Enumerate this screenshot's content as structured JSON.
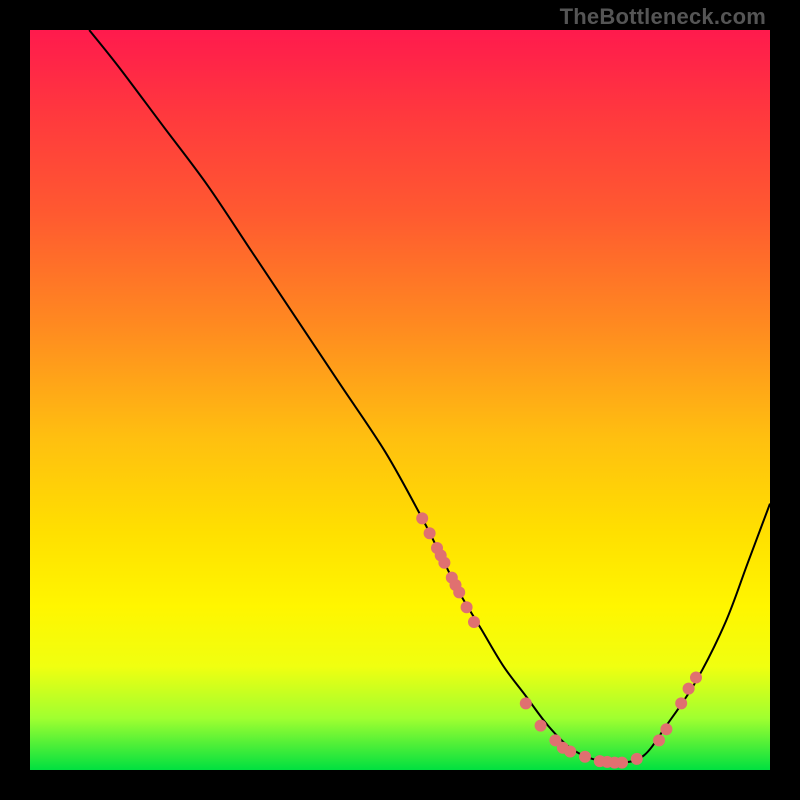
{
  "watermark": "TheBottleneck.com",
  "colors": {
    "dot": "#e07070",
    "curve": "#000000",
    "background_frame": "#000000"
  },
  "chart_data": {
    "type": "line",
    "title": "",
    "xlabel": "",
    "ylabel": "",
    "xlim": [
      0,
      100
    ],
    "ylim": [
      0,
      100
    ],
    "note": "Axes are unlabeled; values are estimated from pixel positions on a 0–100 normalized canvas, y measured from bottom (so 100 = top, 0 = bottom).",
    "series": [
      {
        "name": "curve",
        "x": [
          8,
          12,
          18,
          24,
          30,
          36,
          42,
          48,
          53,
          56,
          58,
          61,
          64,
          67,
          70,
          73,
          76,
          80,
          83,
          86,
          90,
          94,
          97,
          100
        ],
        "y": [
          100,
          95,
          87,
          79,
          70,
          61,
          52,
          43,
          34,
          28,
          24,
          19,
          14,
          10,
          6,
          3,
          1.5,
          1,
          2,
          6,
          12,
          20,
          28,
          36
        ]
      }
    ],
    "scatter_points": {
      "name": "markers",
      "note": "Salmon dots along the curve, clustered on the descending limb ~x 53–60 and near/after the trough ~x 67–90.",
      "points": [
        {
          "x": 53,
          "y": 34
        },
        {
          "x": 54,
          "y": 32
        },
        {
          "x": 55,
          "y": 30
        },
        {
          "x": 55.5,
          "y": 29
        },
        {
          "x": 56,
          "y": 28
        },
        {
          "x": 57,
          "y": 26
        },
        {
          "x": 57.5,
          "y": 25
        },
        {
          "x": 58,
          "y": 24
        },
        {
          "x": 59,
          "y": 22
        },
        {
          "x": 60,
          "y": 20
        },
        {
          "x": 67,
          "y": 9
        },
        {
          "x": 69,
          "y": 6
        },
        {
          "x": 71,
          "y": 4
        },
        {
          "x": 72,
          "y": 3
        },
        {
          "x": 73,
          "y": 2.5
        },
        {
          "x": 75,
          "y": 1.8
        },
        {
          "x": 77,
          "y": 1.2
        },
        {
          "x": 78,
          "y": 1.1
        },
        {
          "x": 79,
          "y": 1
        },
        {
          "x": 80,
          "y": 1
        },
        {
          "x": 82,
          "y": 1.5
        },
        {
          "x": 85,
          "y": 4
        },
        {
          "x": 86,
          "y": 5.5
        },
        {
          "x": 88,
          "y": 9
        },
        {
          "x": 89,
          "y": 11
        },
        {
          "x": 90,
          "y": 12.5
        }
      ]
    }
  }
}
